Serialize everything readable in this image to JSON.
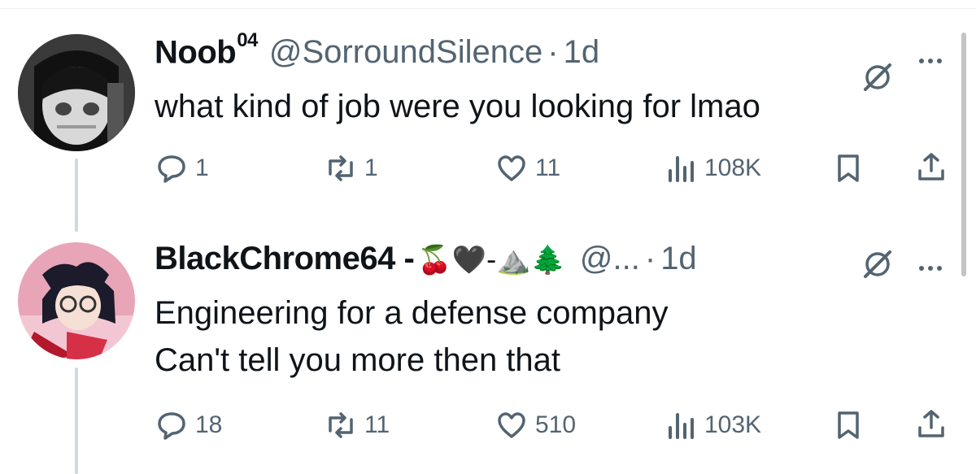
{
  "tweets": [
    {
      "display_name": "Noob",
      "display_name_sup": "04",
      "handle": "@SorroundSilence",
      "separator": "·",
      "time": "1d",
      "text_lines": [
        "what kind of job were you looking for lmao"
      ],
      "replies": "1",
      "reposts": "1",
      "likes": "11",
      "views": "108K"
    },
    {
      "display_name": "BlackChrome64 -",
      "name_emoji": "🍒🖤-⛰️🌲",
      "handle": "@...",
      "separator": "·",
      "time": "1d",
      "text_lines": [
        "Engineering for a defense company",
        "Can't tell you more then that"
      ],
      "replies": "18",
      "reposts": "11",
      "likes": "510",
      "views": "103K"
    }
  ],
  "icons": {
    "reply": "speech-bubble-icon",
    "repost": "repost-arrows-icon",
    "like": "heart-icon",
    "views": "bar-chart-icon",
    "bookmark": "bookmark-icon",
    "share": "share-upload-icon",
    "grok": "grok-slash-icon",
    "more": "more-dots-icon"
  },
  "colors": {
    "text": "#0f1419",
    "secondary": "#536471",
    "thread_line": "#cfd9de"
  }
}
